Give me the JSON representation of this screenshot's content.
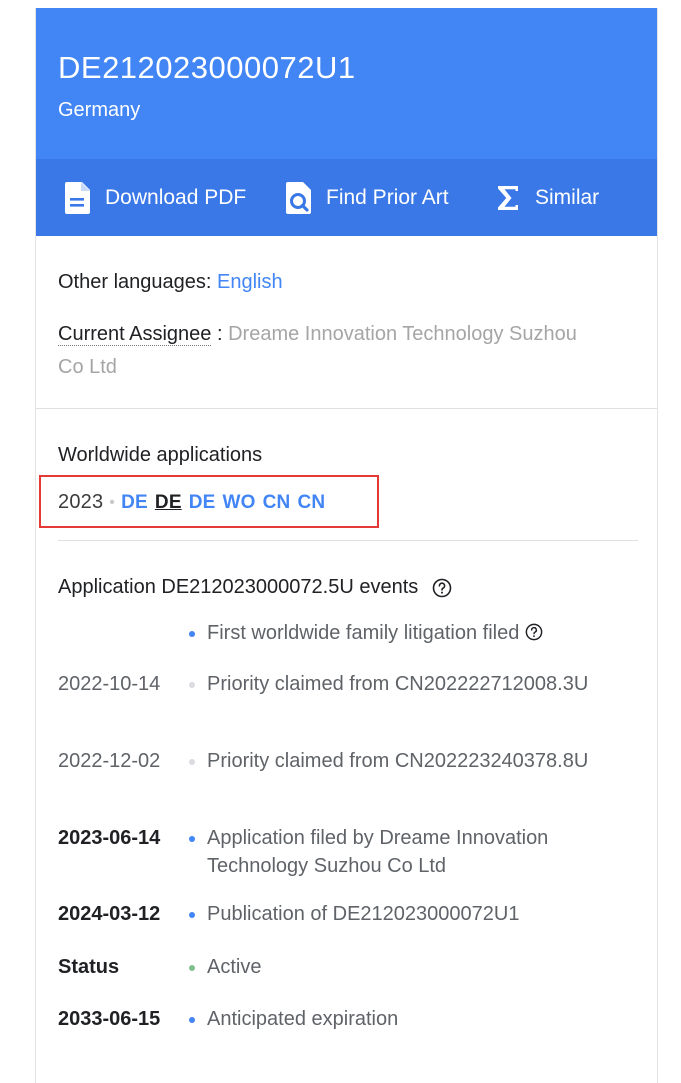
{
  "header": {
    "publication_number": "DE212023000072U1",
    "country": "Germany"
  },
  "toolbar": {
    "download_label": "Download PDF",
    "prior_art_label": "Find Prior Art",
    "similar_label": "Similar",
    "icons": [
      "document-icon",
      "search-document-icon",
      "sigma-icon"
    ]
  },
  "info": {
    "other_languages_label": "Other languages:",
    "other_languages_value": "English",
    "assignee_label": "Current Assignee",
    "assignee_separator": " : ",
    "assignee_value": "Dreame Innovation Technology Suzhou Co Ltd"
  },
  "worldwide": {
    "title": "Worldwide applications",
    "year": "2023",
    "codes": [
      "DE",
      "DE",
      "DE",
      "WO",
      "CN",
      "CN"
    ],
    "current_index": 1
  },
  "events": {
    "title": "Application DE212023000072.5U events",
    "items": [
      {
        "date": "",
        "text": "First worldwide family litigation filed",
        "bold": false,
        "bullet": "#4285f4",
        "help": true
      },
      {
        "date": "2022-10-14",
        "text": "Priority claimed from CN202222712008.3U",
        "bold": false,
        "bullet": "#dadce0"
      },
      {
        "date": "2022-12-02",
        "text": "Priority claimed from CN202223240378.8U",
        "bold": false,
        "bullet": "#dadce0"
      },
      {
        "date": "2023-06-14",
        "text": "Application filed by Dreame Innovation Technology Suzhou Co Ltd",
        "bold": true,
        "bullet": "#4285f4"
      },
      {
        "date": "2024-03-12",
        "text": "Publication of DE212023000072U1",
        "bold": true,
        "bullet": "#4285f4"
      },
      {
        "date": "Status",
        "text": "Active",
        "bold": true,
        "bullet": "#7cc189"
      },
      {
        "date": "2033-06-15",
        "text": "Anticipated expiration",
        "bold": true,
        "bullet": "#4285f4"
      }
    ]
  },
  "colors": {
    "header_bg": "#4285f4",
    "toolbar_bg": "#3b78e7",
    "link": "#4285f4",
    "highlight": "#e53935"
  }
}
